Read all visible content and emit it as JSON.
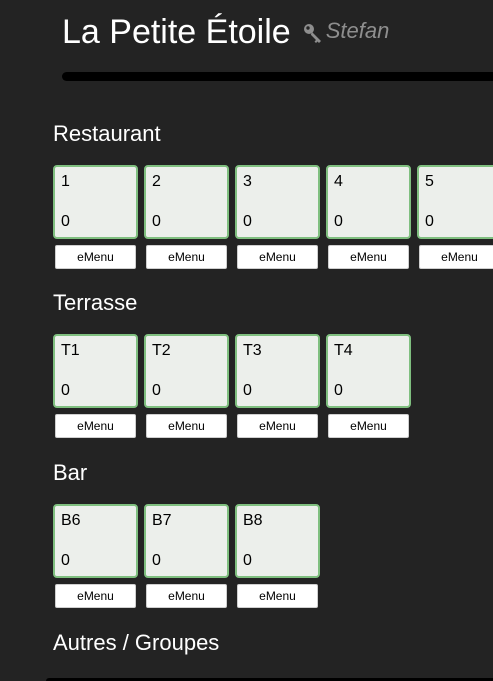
{
  "header": {
    "title": "La Petite Étoile",
    "user": "Stefan"
  },
  "sections": [
    {
      "title": "Restaurant",
      "tables": [
        {
          "name": "1",
          "count": "0",
          "button": "eMenu"
        },
        {
          "name": "2",
          "count": "0",
          "button": "eMenu"
        },
        {
          "name": "3",
          "count": "0",
          "button": "eMenu"
        },
        {
          "name": "4",
          "count": "0",
          "button": "eMenu"
        },
        {
          "name": "5",
          "count": "0",
          "button": "eMenu"
        }
      ]
    },
    {
      "title": "Terrasse",
      "tables": [
        {
          "name": "T1",
          "count": "0",
          "button": "eMenu"
        },
        {
          "name": "T2",
          "count": "0",
          "button": "eMenu"
        },
        {
          "name": "T3",
          "count": "0",
          "button": "eMenu"
        },
        {
          "name": "T4",
          "count": "0",
          "button": "eMenu"
        }
      ]
    },
    {
      "title": "Bar",
      "tables": [
        {
          "name": "B6",
          "count": "0",
          "button": "eMenu"
        },
        {
          "name": "B7",
          "count": "0",
          "button": "eMenu"
        },
        {
          "name": "B8",
          "count": "0",
          "button": "eMenu"
        }
      ]
    },
    {
      "title": "Autres / Groupes",
      "tables": []
    }
  ],
  "icons": {
    "user_icon": "key-icon"
  },
  "colors": {
    "background": "#232323",
    "card_fill": "#ecefeb",
    "card_border": "#7fbf7f",
    "user_text": "#8e8e8e"
  }
}
